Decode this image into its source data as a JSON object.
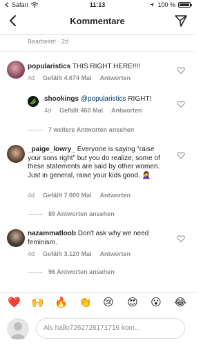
{
  "status": {
    "carrier": "Safari",
    "time": "11:13",
    "battery": "100 %"
  },
  "nav": {
    "title": "Kommentare"
  },
  "edited": "Bearbeitet · 2d",
  "comments": [
    {
      "username": "popularistics",
      "text": "THIS RIGHT HERE!!!!",
      "age": "4d",
      "likes": "Gefällt 4.674 Mal",
      "reply": "Antworten",
      "more": ""
    },
    {
      "username": "shookings",
      "mention": "@popularistics",
      "text": "RIGHT!",
      "age": "4d",
      "likes": "Gefällt 460 Mal",
      "reply": "Antworten",
      "more": "7 weitere Antworten ansehen"
    },
    {
      "username": "_paige_lowry_",
      "text": "Everyone is saying “raise your sons right” but you do realize, some of these statements are said by other women. Just in general, raise your kids good. 🤦‍♀️",
      "age": "4d",
      "likes": "Gefällt 7.000 Mal",
      "reply": "Antworten",
      "more": "89 Antworten ansehen"
    },
    {
      "username": "nazammatloob",
      "text": "Don't ask why we need feminism.",
      "age": "4d",
      "likes": "Gefällt 3.120 Mal",
      "reply": "Antworten",
      "more": "96 Antworten ansehen"
    }
  ],
  "emoji_bar": [
    "❤️",
    "🙌",
    "🔥",
    "👏",
    "😢",
    "😍",
    "😮",
    "😂"
  ],
  "composer": {
    "placeholder": "Als hallo7262726171716 kom..."
  }
}
